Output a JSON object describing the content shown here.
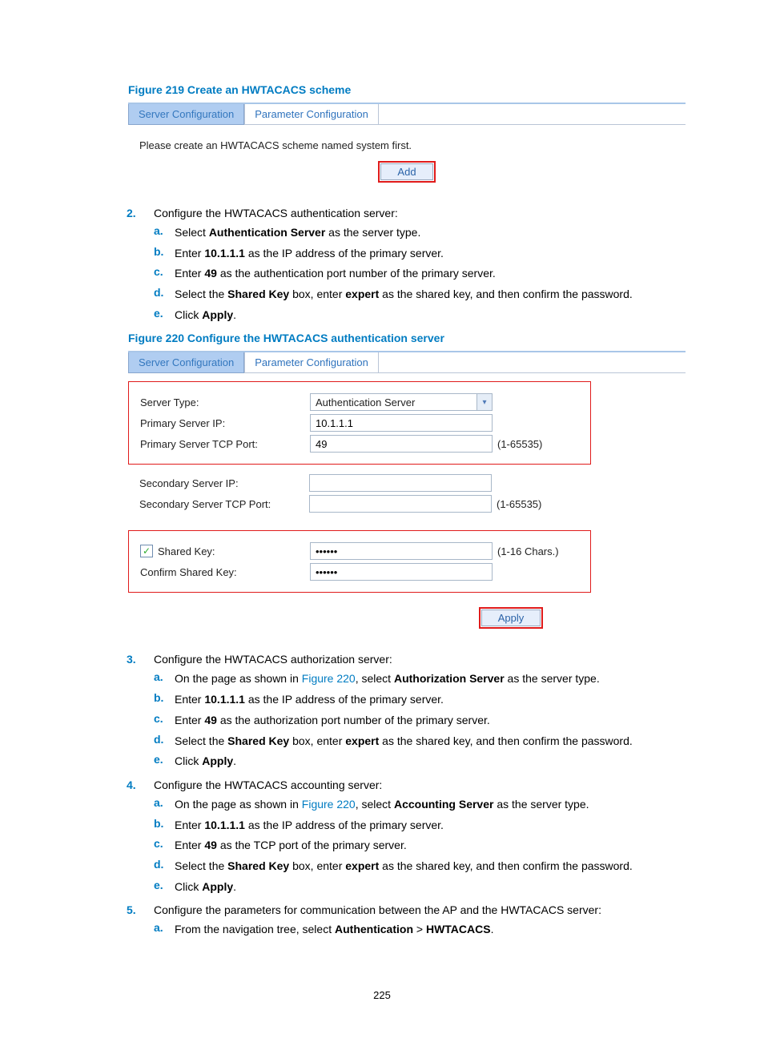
{
  "fig219": {
    "caption": "Figure 219 Create an HWTACACS scheme",
    "tab_active": "Server Configuration",
    "tab_inactive": "Parameter Configuration",
    "message": "Please create an HWTACACS scheme named system first.",
    "add_btn": "Add"
  },
  "step2": {
    "num": "2.",
    "text": "Configure the HWTACACS authentication server:",
    "a": {
      "l": "a.",
      "prefix": "Select ",
      "bold": "Authentication Server",
      "suffix": " as the server type."
    },
    "b": {
      "l": "b.",
      "prefix": "Enter ",
      "bold": "10.1.1.1",
      "suffix": " as the IP address of the primary server."
    },
    "c": {
      "l": "c.",
      "prefix": "Enter ",
      "bold": "49",
      "suffix": " as the authentication port number of the primary server."
    },
    "d": {
      "l": "d.",
      "prefix": "Select the ",
      "b1": "Shared Key",
      "mid": " box, enter ",
      "b2": "expert",
      "suffix": " as the shared key, and then confirm the password."
    },
    "e": {
      "l": "e.",
      "prefix": "Click ",
      "bold": "Apply",
      "suffix": "."
    }
  },
  "fig220": {
    "caption": "Figure 220 Configure the HWTACACS authentication server",
    "tab_active": "Server Configuration",
    "tab_inactive": "Parameter Configuration",
    "labels": {
      "server_type": "Server Type:",
      "primary_ip": "Primary Server IP:",
      "primary_port": "Primary Server TCP Port:",
      "secondary_ip": "Secondary Server IP:",
      "secondary_port": "Secondary Server TCP Port:",
      "shared_key": "Shared Key:",
      "confirm_key": "Confirm Shared Key:"
    },
    "values": {
      "server_type": "Authentication Server",
      "primary_ip": "10.1.1.1",
      "primary_port": "49",
      "secondary_ip": "",
      "secondary_port": "",
      "shared_key": "••••••",
      "confirm_key": "••••••"
    },
    "hints": {
      "port": "(1-65535)",
      "key": "(1-16 Chars.)"
    },
    "apply_btn": "Apply"
  },
  "step3": {
    "num": "3.",
    "text": "Configure the HWTACACS authorization server:",
    "a": {
      "l": "a.",
      "prefix": "On the page as shown in ",
      "link": "Figure 220",
      "mid": ", select ",
      "bold": "Authorization Server",
      "suffix": " as the server type."
    },
    "b": {
      "l": "b.",
      "prefix": "Enter ",
      "bold": "10.1.1.1",
      "suffix": " as the IP address of the primary server."
    },
    "c": {
      "l": "c.",
      "prefix": "Enter ",
      "bold": "49",
      "suffix": " as the authorization port number of the primary server."
    },
    "d": {
      "l": "d.",
      "prefix": "Select the ",
      "b1": "Shared Key",
      "mid": " box, enter ",
      "b2": "expert",
      "suffix": " as the shared key, and then confirm the password."
    },
    "e": {
      "l": "e.",
      "prefix": "Click ",
      "bold": "Apply",
      "suffix": "."
    }
  },
  "step4": {
    "num": "4.",
    "text": "Configure the HWTACACS accounting server:",
    "a": {
      "l": "a.",
      "prefix": "On the page as shown in ",
      "link": "Figure 220",
      "mid": ", select ",
      "bold": "Accounting Server",
      "suffix": " as the server type."
    },
    "b": {
      "l": "b.",
      "prefix": "Enter ",
      "bold": "10.1.1.1",
      "suffix": " as the IP address of the primary server."
    },
    "c": {
      "l": "c.",
      "prefix": "Enter ",
      "bold": "49",
      "suffix": " as the TCP port of the primary server."
    },
    "d": {
      "l": "d.",
      "prefix": "Select the ",
      "b1": "Shared Key",
      "mid": " box, enter ",
      "b2": "expert",
      "suffix": " as the shared key, and then confirm the password."
    },
    "e": {
      "l": "e.",
      "prefix": "Click ",
      "bold": "Apply",
      "suffix": "."
    }
  },
  "step5": {
    "num": "5.",
    "text": "Configure the parameters for communication between the AP and the HWTACACS server:",
    "a": {
      "l": "a.",
      "prefix": "From the navigation tree, select ",
      "b1": "Authentication",
      "sep": " > ",
      "b2": "HWTACACS",
      "suffix": "."
    }
  },
  "page_number": "225"
}
